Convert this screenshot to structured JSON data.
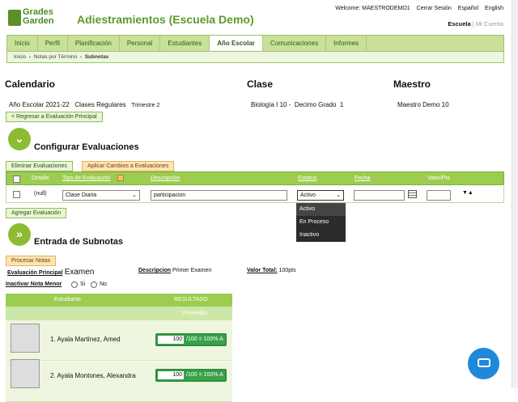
{
  "brand": {
    "line1": "Grades",
    "line2": "Garden"
  },
  "title": "Adiestramientos (Escuela Demo)",
  "topbar": {
    "welcome": "Welcome: MAESTRODEMO1",
    "logout": "Cerrar Sesión",
    "lang_es": "Español",
    "lang_en": "English",
    "escuela": "Escuela",
    "mi_cuenta": "Mi Cuenta"
  },
  "nav": [
    "Inicio",
    "Perfil",
    "Planificación",
    "Personal",
    "Estudiantes",
    "Año Escolar",
    "Comunicaciones",
    "Informes"
  ],
  "nav_active": "Año Escolar",
  "breadcrumb": {
    "a": "Inicio",
    "b": "Notas por Término",
    "c": "Subnotas"
  },
  "info": {
    "cal_title": "Calendario",
    "clase_title": "Clase",
    "maestro_title": "Maestro",
    "year": "Año Escolar 2021-22",
    "clases": "Clases Regulares",
    "trimestre": "Trimestre 2",
    "clase": "Biología I 10 -",
    "grado": "Decimo Grado",
    "grado_num": "1",
    "maestro": "Maestro Demo 10"
  },
  "back_button": "< Regresar a Evaluación Principal",
  "config": {
    "title": "Configurar Evaluaciones",
    "delete_btn": "Eliminar Evaluaciones",
    "apply_btn": "Aplicar Cambios a Evaluaciones",
    "headers": {
      "detalle": "Detalle",
      "tipo": "Tipo de Evaluación",
      "descripcion": "Descripción",
      "estatus": "Estatus",
      "fecha": "Fecha",
      "valor": "Valor/Pts"
    },
    "row": {
      "detalle": "(null)",
      "tipo": "Clase Diaria",
      "descripcion": "participacion",
      "estatus": "Activo",
      "fecha": "",
      "valor": ""
    },
    "status_options": [
      "Activo",
      "En Proceso",
      "Inactivo"
    ],
    "add_btn": "Agregar Evaluación"
  },
  "entry": {
    "title": "Entrada de Subnotas",
    "process_btn": "Procesar Notas",
    "eval_label": "Evaluación Principal",
    "eval_value": "Examen",
    "desc_label": "Descripcion",
    "desc_value": "Primer Examen",
    "total_label": "Valor Total:",
    "total_value": "100pts",
    "inactivar_label": "Inactivar Nota Menor",
    "si": "Si",
    "no": "No",
    "col_estudiante": "Estudiante",
    "col_resultado": "RESULTADO",
    "col_promedio": "Promedio",
    "students": [
      {
        "name": "1. Ayala Martínez, Amed",
        "score": "100",
        "result": "/100 = 100% A"
      },
      {
        "name": "2. Ayala Montones, Alexandra",
        "score": "100",
        "result": "/100 = 100% A"
      }
    ]
  },
  "colors": {
    "green": "#9ccc50",
    "brand": "#5b9a2a",
    "chat": "#1e88d9"
  }
}
